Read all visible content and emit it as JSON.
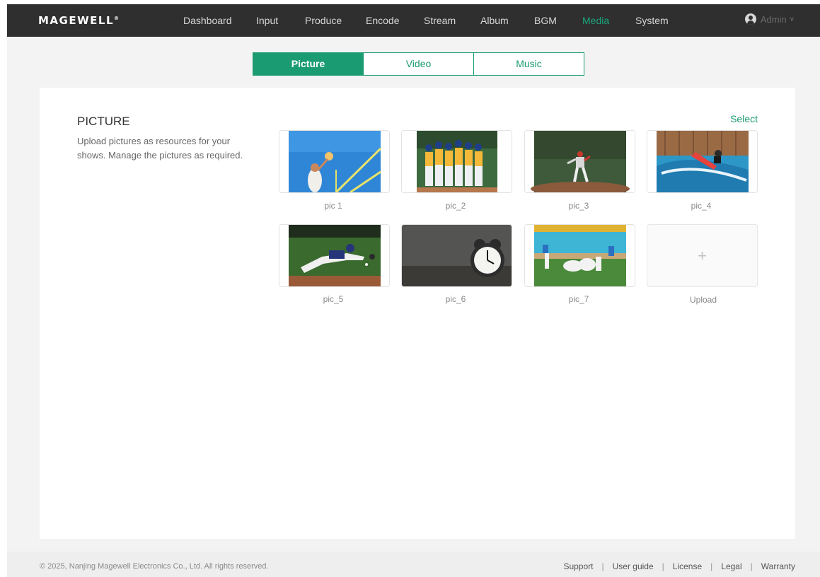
{
  "brand": {
    "logo": "MAGEWELL",
    "mark": "®"
  },
  "nav": {
    "items": [
      "Dashboard",
      "Input",
      "Produce",
      "Encode",
      "Stream",
      "Album",
      "BGM",
      "Media",
      "System"
    ],
    "active": "Media",
    "user": "Admin"
  },
  "tabs": [
    {
      "label": "Picture",
      "active": true
    },
    {
      "label": "Video",
      "active": false
    },
    {
      "label": "Music",
      "active": false
    }
  ],
  "section": {
    "title": "PICTURE",
    "description": "Upload pictures as resources for your shows. Manage the pictures as required.",
    "select_label": "Select"
  },
  "pictures": [
    {
      "name": "pic 1"
    },
    {
      "name": "pic_2"
    },
    {
      "name": "pic_3"
    },
    {
      "name": "pic_4"
    },
    {
      "name": "pic_5"
    },
    {
      "name": "pic_6"
    },
    {
      "name": "pic_7"
    }
  ],
  "upload": {
    "icon": "plus-icon",
    "label": "Upload"
  },
  "footer": {
    "copyright": "© 2025, Nanjing Magewell Electronics Co., Ltd. All rights reserved.",
    "links": [
      "Support",
      "User guide",
      "License",
      "Legal",
      "Warranty"
    ]
  },
  "colors": {
    "accent": "#1a9b72",
    "topbar": "#2f2f2f"
  }
}
